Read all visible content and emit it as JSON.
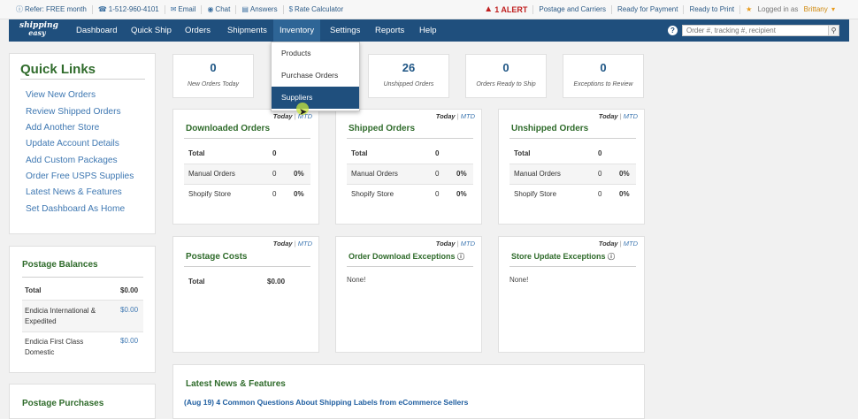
{
  "util": {
    "refer": "Refer: FREE month",
    "phone": "1-512-960-4101",
    "email": "Email",
    "chat": "Chat",
    "answers": "Answers",
    "rate": "Rate Calculator",
    "alert": "1 ALERT",
    "postage_carriers": "Postage and Carriers",
    "ready_payment": "Ready for Payment",
    "ready_print": "Ready to Print",
    "logged_in_prefix": "Logged in as",
    "user": "Brittany"
  },
  "nav": {
    "logo_line1": "shipping",
    "logo_line2": "easy",
    "items": [
      "Dashboard",
      "Quick Ship",
      "Orders",
      "Shipments",
      "Inventory",
      "Settings",
      "Reports",
      "Help"
    ],
    "help_icon": "?",
    "search_placeholder": "Order #, tracking #, recipient"
  },
  "inventory_menu": [
    "Products",
    "Purchase Orders",
    "Suppliers"
  ],
  "quick_links": {
    "title": "Quick Links",
    "items": [
      "View New Orders",
      "Review Shipped Orders",
      "Add Another Store",
      "Update Account Details",
      "Add Custom Packages",
      "Order Free USPS Supplies",
      "Latest News & Features",
      "Set Dashboard As Home"
    ]
  },
  "postage_balances": {
    "title": "Postage Balances",
    "total_label": "Total",
    "total_value": "$0.00",
    "rows": [
      {
        "line1": "Endicia International &",
        "line2": "Expedited",
        "value": "$0.00"
      },
      {
        "line1": "Endicia First Class",
        "line2": "Domestic",
        "value": "$0.00"
      }
    ]
  },
  "postage_purchases": {
    "title": "Postage Purchases"
  },
  "stats": [
    {
      "value": "0",
      "label": "New Orders Today"
    },
    {
      "value": "26",
      "label": "Unshipped Orders"
    },
    {
      "value": "0",
      "label": "Orders Ready to Ship"
    },
    {
      "value": "0",
      "label": "Exceptions to Review"
    }
  ],
  "toggle": {
    "today": "Today",
    "sep": "|",
    "mtd": "MTD"
  },
  "order_cards": [
    {
      "title": "Downloaded Orders",
      "total_label": "Total",
      "total": "0",
      "rows": [
        {
          "label": "Manual Orders",
          "count": "0",
          "pct": "0%"
        },
        {
          "label": "Shopify Store",
          "count": "0",
          "pct": "0%"
        }
      ]
    },
    {
      "title": "Shipped Orders",
      "total_label": "Total",
      "total": "0",
      "rows": [
        {
          "label": "Manual Orders",
          "count": "0",
          "pct": "0%"
        },
        {
          "label": "Shopify Store",
          "count": "0",
          "pct": "0%"
        }
      ]
    },
    {
      "title": "Unshipped Orders",
      "total_label": "Total",
      "total": "0",
      "rows": [
        {
          "label": "Manual Orders",
          "count": "0",
          "pct": "0%"
        },
        {
          "label": "Shopify Store",
          "count": "0",
          "pct": "0%"
        }
      ]
    }
  ],
  "postage_costs": {
    "title": "Postage Costs",
    "total_label": "Total",
    "total": "$0.00"
  },
  "download_exceptions": {
    "title": "Order Download Exceptions",
    "none": "None!"
  },
  "store_exceptions": {
    "title": "Store Update Exceptions",
    "none": "None!"
  },
  "news": {
    "title": "Latest News & Features",
    "link": "(Aug 19) 4 Common Questions About Shipping Labels from eCommerce Sellers"
  }
}
